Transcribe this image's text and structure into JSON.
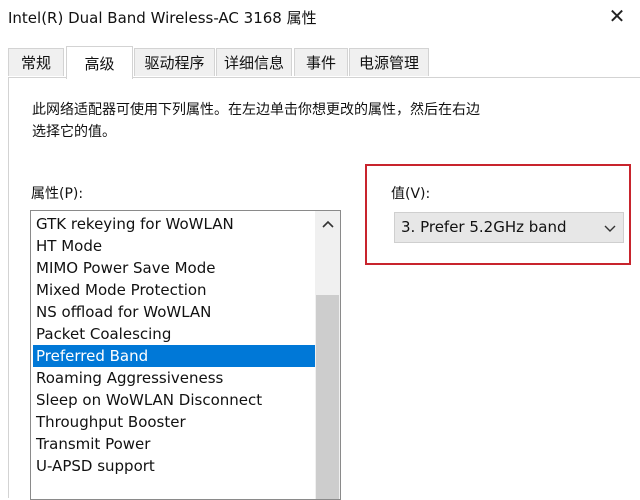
{
  "window": {
    "title": "Intel(R) Dual Band Wireless-AC 3168 属性",
    "close_glyph": "✕"
  },
  "tabs": [
    {
      "label": "常规"
    },
    {
      "label": "高级",
      "active": true
    },
    {
      "label": "驱动程序"
    },
    {
      "label": "详细信息"
    },
    {
      "label": "事件"
    },
    {
      "label": "电源管理"
    }
  ],
  "panel": {
    "description_line1": "此网络适配器可使用下列属性。在左边单击你想更改的属性，然后在右边",
    "description_line2": "选择它的值。",
    "property_label": "属性(P):",
    "value_label": "值(V):"
  },
  "properties": [
    "GTK rekeying for WoWLAN",
    "HT Mode",
    "MIMO Power Save Mode",
    "Mixed Mode Protection",
    "NS offload for WoWLAN",
    "Packet Coalescing",
    "Preferred Band",
    "Roaming Aggressiveness",
    "Sleep on WoWLAN Disconnect",
    "Throughput Booster",
    "Transmit Power",
    "U-APSD support"
  ],
  "selected_property": "Preferred Band",
  "value": {
    "selected": "3. Prefer 5.2GHz band"
  },
  "icons": {
    "scroll_up": "chevron-up-icon",
    "dropdown": "chevron-down-icon",
    "close": "close-icon"
  },
  "colors": {
    "selection": "#0078d7",
    "highlight_border": "#c8242d"
  }
}
